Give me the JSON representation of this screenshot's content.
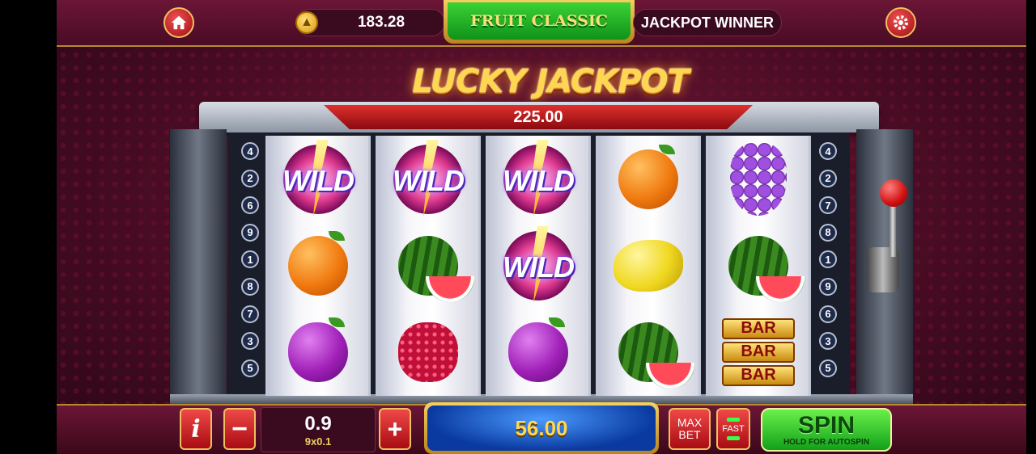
{
  "header": {
    "balance": "183.28",
    "game_title": "FRUIT CLASSIC",
    "jackpot_winner_label": "JACKPOT WINNER"
  },
  "logo_text": "LUCKY JACKPOT",
  "jackpot_amount": "225.00",
  "paylines_left": [
    "4",
    "2",
    "6",
    "9",
    "1",
    "8",
    "7",
    "3",
    "5"
  ],
  "paylines_right": [
    "4",
    "2",
    "7",
    "8",
    "1",
    "9",
    "6",
    "3",
    "5"
  ],
  "reels": [
    [
      "wild",
      "orange",
      "plum"
    ],
    [
      "wild",
      "watermelon",
      "raspberry"
    ],
    [
      "wild",
      "wild",
      "plum"
    ],
    [
      "orange",
      "lemon",
      "watermelon"
    ],
    [
      "grapes",
      "watermelon",
      "bar"
    ]
  ],
  "wild_label": "WILD",
  "bar_label": "BAR",
  "controls": {
    "info_label": "i",
    "minus_label": "−",
    "plus_label": "+",
    "bet_value": "0.9",
    "bet_detail": "9x0.1",
    "win_amount": "56.00",
    "maxbet_line1": "MAX",
    "maxbet_line2": "BET",
    "fast_label": "FAST",
    "spin_label": "SPIN",
    "spin_sub": "HOLD FOR AUTOSPIN"
  },
  "icons": {
    "home": "home-icon",
    "settings": "gear-icon",
    "coin": "coin-icon"
  }
}
